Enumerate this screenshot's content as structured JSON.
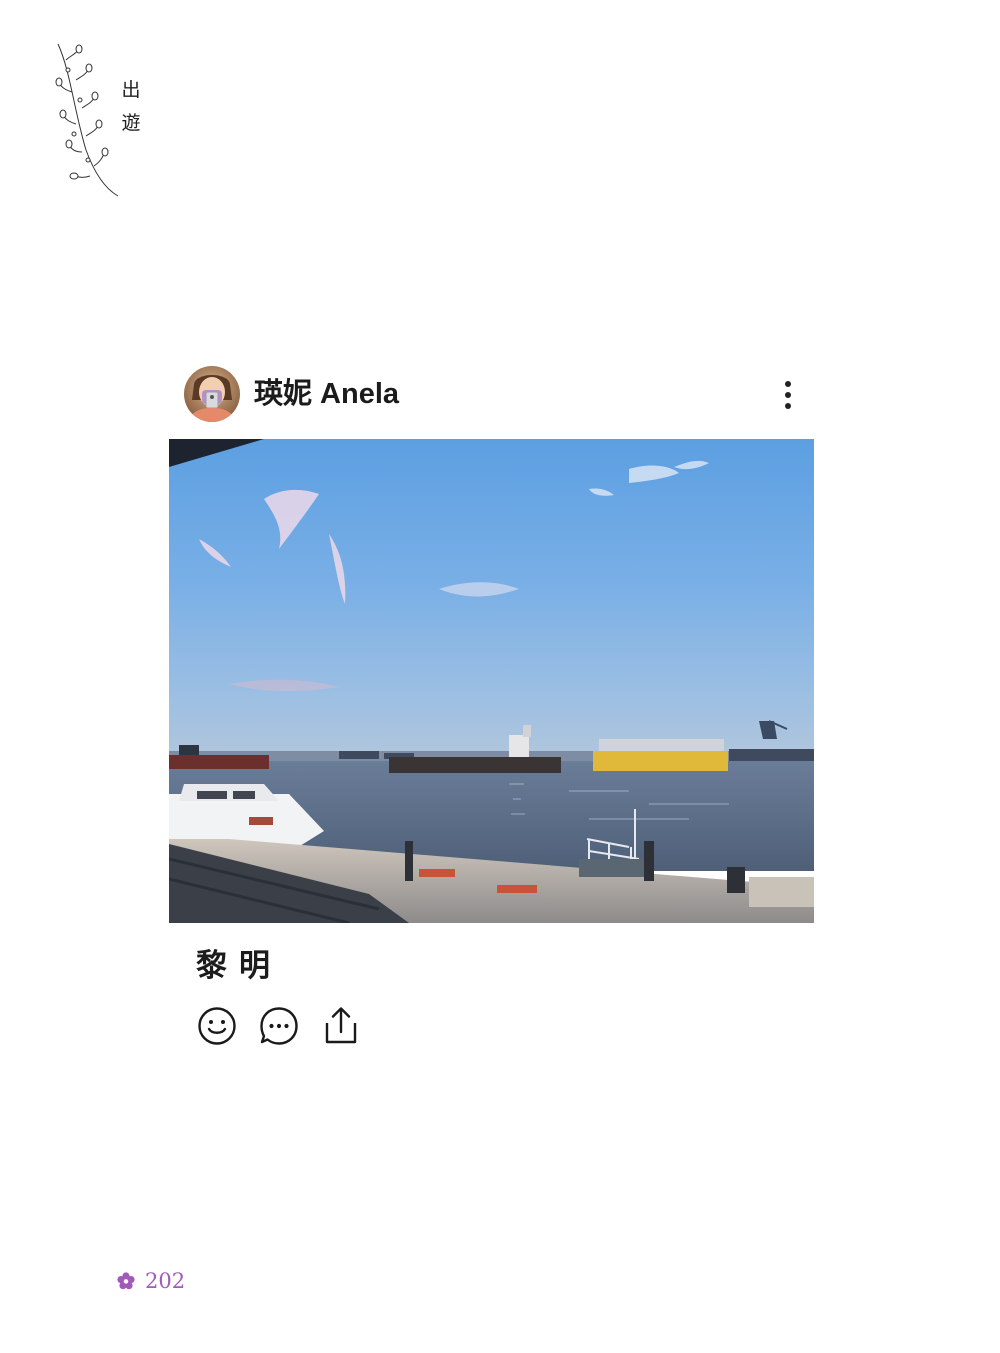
{
  "page": {
    "chapter_title": [
      "出",
      "遊"
    ],
    "page_number": "202",
    "accent_color": "#a15ab8"
  },
  "post": {
    "author": "瑛妮 Anela",
    "caption": "黎明",
    "image_subject": "harbor",
    "actions": [
      "smiley-icon",
      "comment-icon",
      "share-icon"
    ],
    "menu_icon": "more-vertical-icon"
  }
}
